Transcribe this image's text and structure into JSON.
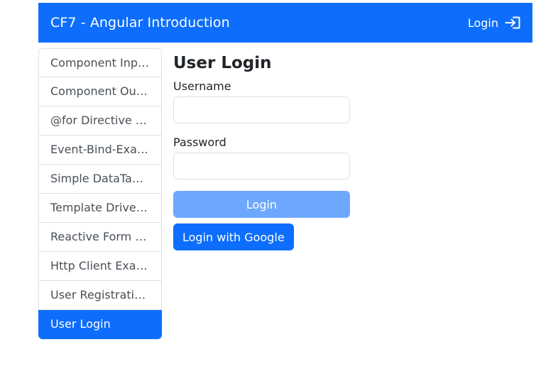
{
  "navbar": {
    "brand": "CF7 - Angular Introduction",
    "login_label": "Login",
    "login_icon": "box-arrow-in-right-icon",
    "background": "#0d6efd"
  },
  "sidebar": {
    "items": [
      {
        "label": "Component Input Example",
        "active": false
      },
      {
        "label": "Component Output Example",
        "active": false
      },
      {
        "label": "@for Directive Example",
        "active": false
      },
      {
        "label": "Event-Bind-Example",
        "active": false
      },
      {
        "label": "Simple DataTable Example",
        "active": false
      },
      {
        "label": "Template Driven Form Example",
        "active": false
      },
      {
        "label": "Reactive Form Example",
        "active": false
      },
      {
        "label": "Http Client Example",
        "active": false
      },
      {
        "label": "User Registration Example",
        "active": false
      },
      {
        "label": "User Login",
        "active": true
      }
    ],
    "active_color": "#0d6efd"
  },
  "main": {
    "title": "User Login",
    "username": {
      "label": "Username",
      "value": "",
      "placeholder": ""
    },
    "password": {
      "label": "Password",
      "value": "",
      "placeholder": ""
    },
    "login_button": "Login",
    "login_button_disabled": true,
    "google_button": "Login with Google"
  }
}
